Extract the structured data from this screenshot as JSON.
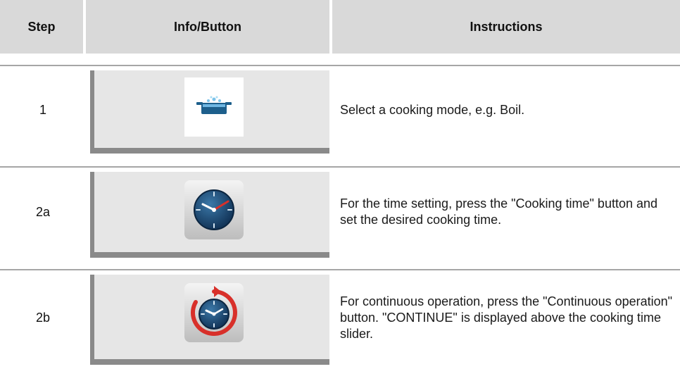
{
  "header": {
    "step": "Step",
    "info": "Info/Button",
    "instructions": "Instructions"
  },
  "rows": [
    {
      "step": "1",
      "icon": "pot-boil-icon",
      "instruction": "Select a cooking mode, e.g. Boil."
    },
    {
      "step": "2a",
      "icon": "cooking-time-clock-icon",
      "instruction": "For the time setting, press the \"Cooking time\" button and set the desired cooking time."
    },
    {
      "step": "2b",
      "icon": "continuous-operation-clock-icon",
      "instruction": "For continuous operation, press the \"Continuous operation\" button. \"CONTINUE\" is displayed above the cooking time slider."
    }
  ],
  "colors": {
    "header_bg": "#d9d9d9",
    "panel_bg": "#e6e6e6",
    "panel_shade": "#8a8a8a",
    "divider": "#a6a6a6",
    "clock_blue": "#1f4e7a",
    "hand_red": "#d8302a",
    "pot_blue": "#1d5f8c"
  }
}
